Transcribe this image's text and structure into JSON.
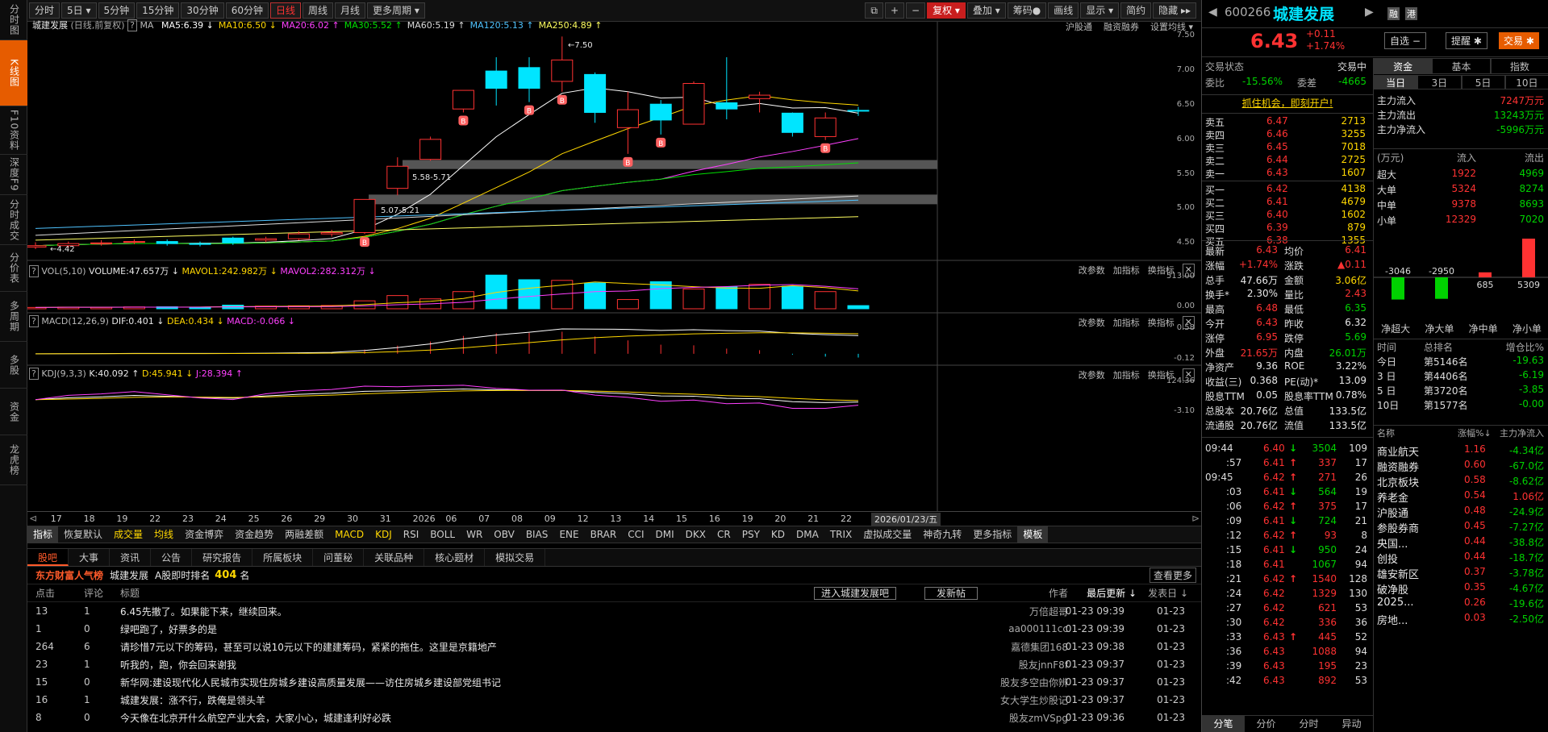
{
  "leftnav": [
    {
      "label": "分时图",
      "on": false,
      "h": 50
    },
    {
      "label": "K线图",
      "on": true,
      "h": 82
    },
    {
      "label": "F10资料",
      "on": false,
      "h": 60
    },
    {
      "label": "深度F9",
      "on": false,
      "h": 50
    },
    {
      "label": "分时成交",
      "on": false,
      "h": 62
    },
    {
      "label": "分价表",
      "on": false,
      "h": 58
    },
    {
      "label": "多周期",
      "on": false,
      "h": 62
    },
    {
      "label": "多股",
      "on": false,
      "h": 58
    },
    {
      "label": "资金",
      "on": false,
      "h": 58
    },
    {
      "label": "龙虎榜",
      "on": false,
      "h": 62
    }
  ],
  "toolbar": {
    "left": [
      "分时",
      "5日 ▾",
      "5分钟",
      "15分钟",
      "30分钟",
      "60分钟",
      "日线",
      "周线",
      "月线",
      "更多周期 ▾"
    ],
    "active": "日线",
    "right": [
      "⧉",
      "+",
      "−",
      "复权 ▾",
      "叠加 ▾",
      "筹码●",
      "画线",
      "显示 ▾",
      "简约",
      "隐藏 ▸▸"
    ]
  },
  "chart": {
    "title": "城建发展",
    "subtitle": "(日线,前复权)",
    "ma_label": "MA",
    "ma": [
      {
        "t": "MA5:6.39 ↓",
        "c": "#ffffff"
      },
      {
        "t": "MA10:6.50 ↓",
        "c": "#ffd700"
      },
      {
        "t": "MA20:6.02 ↑",
        "c": "#ff40ff"
      },
      {
        "t": "MA30:5.52 ↑",
        "c": "#00e000"
      },
      {
        "t": "MA60:5.19 ↑",
        "c": "#dddddd"
      },
      {
        "t": "MA120:5.13 ↑",
        "c": "#4fc3ff"
      },
      {
        "t": "MA250:4.89 ↑",
        "c": "#ffff60"
      }
    ],
    "toplinks": [
      "沪股通",
      "融资融券",
      "设置均线 ▾"
    ],
    "price_ticks": [
      "7.50",
      "7.00",
      "6.50",
      "6.00",
      "5.50",
      "5.00",
      "4.50"
    ],
    "hi_label": "←7.50",
    "lo_label": "←4.42",
    "zone1_label": "5.58-5.71",
    "zone2_label": "5.07-5.21",
    "vol": {
      "label": "VOL(5,10)",
      "v1": "VOLUME:47.657万 ↓",
      "v2": "MAVOL1:242.982万 ↓",
      "v3": "MAVOL2:282.312万 ↓",
      "ticks": [
        "513.00",
        "0.00"
      ]
    },
    "macd": {
      "label": "MACD(12,26,9)",
      "v1": "DIF:0.401 ↓",
      "v2": "DEA:0.434 ↓",
      "v3": "MACD:-0.066 ↓",
      "ticks": [
        "0.58",
        "-0.12"
      ]
    },
    "kdj": {
      "label": "KDJ(9,3,3)",
      "v1": "K:40.092 ↑",
      "v2": "D:45.941 ↓",
      "v3": "J:28.394 ↑",
      "ticks": [
        "124.36",
        "-3.10"
      ]
    },
    "panel_btns": [
      "改参数",
      "加指标",
      "换指标"
    ],
    "dates": [
      "17",
      "18",
      "19",
      "22",
      "23",
      "24",
      "25",
      "26",
      "29",
      "30",
      "31",
      "2026",
      "06",
      "07",
      "08",
      "09",
      "12",
      "13",
      "14",
      "15",
      "16",
      "19",
      "20",
      "21",
      "22"
    ],
    "date_box": "2026/01/23/五"
  },
  "chart_data": {
    "type": "candlestick",
    "ylim": [
      4.35,
      7.55
    ],
    "candles": [
      [
        4.45,
        4.47,
        4.42,
        4.52
      ],
      [
        4.47,
        4.5,
        4.44,
        4.53
      ],
      [
        4.5,
        4.51,
        4.47,
        4.55
      ],
      [
        4.52,
        4.53,
        4.49,
        4.56
      ],
      [
        4.53,
        4.5,
        4.47,
        4.56
      ],
      [
        4.5,
        4.49,
        4.46,
        4.53
      ],
      [
        4.58,
        4.51,
        4.48,
        4.6
      ],
      [
        4.55,
        4.57,
        4.52,
        4.6
      ],
      [
        4.57,
        4.64,
        4.55,
        4.68
      ],
      [
        4.64,
        4.66,
        4.6,
        4.7
      ],
      [
        4.66,
        5.14,
        4.64,
        5.14
      ],
      [
        5.3,
        5.62,
        5.2,
        5.75
      ],
      [
        5.72,
        6.01,
        5.7,
        6.05
      ],
      [
        6.45,
        6.72,
        6.4,
        6.72
      ],
      [
        7.0,
        6.75,
        6.5,
        7.2
      ],
      [
        7.05,
        6.75,
        6.55,
        7.2
      ],
      [
        6.85,
        7.16,
        6.7,
        7.5
      ],
      [
        6.95,
        6.4,
        6.25,
        6.98
      ],
      [
        6.18,
        6.44,
        5.8,
        6.7
      ],
      [
        6.52,
        6.29,
        6.08,
        6.58
      ],
      [
        6.23,
        6.82,
        6.23,
        6.85
      ],
      [
        6.54,
        6.45,
        6.3,
        7.2
      ],
      [
        6.6,
        6.65,
        6.4,
        6.7
      ],
      [
        6.39,
        6.11,
        6.05,
        6.4
      ],
      [
        6.05,
        6.32,
        6.0,
        6.4
      ],
      [
        6.43,
        6.42,
        6.35,
        6.48
      ]
    ],
    "volume_max": 513,
    "volume": [
      20,
      25,
      22,
      28,
      30,
      25,
      55,
      40,
      45,
      50,
      120,
      200,
      150,
      260,
      510,
      440,
      430,
      390,
      140,
      410,
      300,
      330,
      370,
      340,
      260,
      47.657
    ]
  },
  "quote": {
    "code": "600266",
    "name": "城建发展",
    "price": "6.43",
    "chg": "+0.11",
    "pct": "+1.74%",
    "btn_pick": "自选 −",
    "btn_remind": "提醒 ✱",
    "btn_trade": "交易 ✱",
    "tag1": "融",
    "tag2": "港",
    "trade_state": "交易状态",
    "trade_state_v": "交易中",
    "wb_label": "委比",
    "wb": "-15.56%",
    "wc_label": "委差",
    "wc": "-4665",
    "promo": "抓住机会，即刻开户!"
  },
  "sells": [
    {
      "n": "卖五",
      "p": "6.47",
      "v": "2713"
    },
    {
      "n": "卖四",
      "p": "6.46",
      "v": "3255"
    },
    {
      "n": "卖三",
      "p": "6.45",
      "v": "7018"
    },
    {
      "n": "卖二",
      "p": "6.44",
      "v": "2725"
    },
    {
      "n": "卖一",
      "p": "6.43",
      "v": "1607"
    }
  ],
  "buys": [
    {
      "n": "买一",
      "p": "6.42",
      "v": "4138"
    },
    {
      "n": "买二",
      "p": "6.41",
      "v": "4679"
    },
    {
      "n": "买三",
      "p": "6.40",
      "v": "1602"
    },
    {
      "n": "买四",
      "p": "6.39",
      "v": "879"
    },
    {
      "n": "买五",
      "p": "6.38",
      "v": "1355"
    }
  ],
  "stats": [
    [
      "最新",
      "6.43",
      "red",
      "均价",
      "6.41",
      "red"
    ],
    [
      "涨幅",
      "+1.74%",
      "red",
      "涨跌",
      "▲0.11",
      "red"
    ],
    [
      "总手",
      "47.66万",
      "wh",
      "金额",
      "3.06亿",
      "yel"
    ],
    [
      "换手*",
      "2.30%",
      "wh",
      "量比",
      "2.43",
      "red"
    ],
    [
      "最高",
      "6.48",
      "red",
      "最低",
      "6.35",
      "green"
    ],
    [
      "今开",
      "6.43",
      "red",
      "昨收",
      "6.32",
      "wh"
    ],
    [
      "涨停",
      "6.95",
      "red",
      "跌停",
      "5.69",
      "green"
    ],
    [
      "外盘",
      "21.65万",
      "red",
      "内盘",
      "26.01万",
      "green"
    ],
    [
      "净资产",
      "9.36",
      "wh",
      "ROE",
      "3.22%",
      "wh"
    ],
    [
      "收益(三)",
      "0.368",
      "wh",
      "PE(动)*",
      "13.09",
      "wh"
    ],
    [
      "股息TTM",
      "0.05",
      "wh",
      "股息率TTM",
      "0.78%",
      "wh"
    ],
    [
      "总股本",
      "20.76亿",
      "wh",
      "总值",
      "133.5亿",
      "wh"
    ],
    [
      "流通股",
      "20.76亿",
      "wh",
      "流值",
      "133.5亿",
      "wh"
    ]
  ],
  "ticks": [
    {
      "t": "09:44",
      "p": "6.40",
      "a": "↓",
      "c": "green",
      "v": "3504",
      "n": "109"
    },
    {
      "t": ":57",
      "p": "6.41",
      "a": "↑",
      "c": "red",
      "v": "337",
      "n": "17"
    },
    {
      "t": "09:45",
      "p": "6.42",
      "a": "↑",
      "c": "red",
      "v": "271",
      "n": "26"
    },
    {
      "t": ":03",
      "p": "6.41",
      "a": "↓",
      "c": "green",
      "v": "564",
      "n": "19"
    },
    {
      "t": ":06",
      "p": "6.42",
      "a": "↑",
      "c": "red",
      "v": "375",
      "n": "17"
    },
    {
      "t": ":09",
      "p": "6.41",
      "a": "↓",
      "c": "green",
      "v": "724",
      "n": "21"
    },
    {
      "t": ":12",
      "p": "6.42",
      "a": "↑",
      "c": "red",
      "v": "93",
      "n": "8"
    },
    {
      "t": ":15",
      "p": "6.41",
      "a": "↓",
      "c": "green",
      "v": "950",
      "n": "24"
    },
    {
      "t": ":18",
      "p": "6.41",
      "a": "",
      "c": "green",
      "v": "1067",
      "n": "94"
    },
    {
      "t": ":21",
      "p": "6.42",
      "a": "↑",
      "c": "red",
      "v": "1540",
      "n": "128"
    },
    {
      "t": ":24",
      "p": "6.42",
      "a": "",
      "c": "red",
      "v": "1329",
      "n": "130"
    },
    {
      "t": ":27",
      "p": "6.42",
      "a": "",
      "c": "red",
      "v": "621",
      "n": "53"
    },
    {
      "t": ":30",
      "p": "6.42",
      "a": "",
      "c": "red",
      "v": "336",
      "n": "36"
    },
    {
      "t": ":33",
      "p": "6.43",
      "a": "↑",
      "c": "red",
      "v": "445",
      "n": "52"
    },
    {
      "t": ":36",
      "p": "6.43",
      "a": "",
      "c": "red",
      "v": "1088",
      "n": "94"
    },
    {
      "t": ":39",
      "p": "6.43",
      "a": "",
      "c": "red",
      "v": "195",
      "n": "23"
    },
    {
      "t": ":42",
      "p": "6.43",
      "a": "",
      "c": "red",
      "v": "892",
      "n": "53"
    }
  ],
  "tick_tabs": [
    "分笔",
    "分价",
    "分时",
    "异动"
  ],
  "money": {
    "tabs": [
      "资金",
      "基本",
      "指数"
    ],
    "subtabs": [
      "当日",
      "3日",
      "5日",
      "10日"
    ],
    "rows": [
      {
        "l": "主力流入",
        "v": "7247万元",
        "c": "red"
      },
      {
        "l": "主力流出",
        "v": "13243万元",
        "c": "green"
      },
      {
        "l": "主力净流入",
        "v": "-5996万元",
        "c": "green"
      }
    ],
    "head": [
      "(万元)",
      "流入",
      "流出"
    ],
    "grid": [
      {
        "l": "超大",
        "i": "1922",
        "o": "4969"
      },
      {
        "l": "大单",
        "i": "5324",
        "o": "8274"
      },
      {
        "l": "中单",
        "i": "9378",
        "o": "8693"
      },
      {
        "l": "小单",
        "i": "12329",
        "o": "7020"
      }
    ],
    "bars": [
      {
        "v": "-3046",
        "val": -3046
      },
      {
        "v": "-2950",
        "val": -2950
      },
      {
        "v": "685",
        "val": 685
      },
      {
        "v": "5309",
        "val": 5309
      }
    ],
    "bar_labels": [
      "净超大",
      "净大单",
      "净中单",
      "净小单"
    ],
    "rank_head": [
      "时间",
      "总排名",
      "增仓比%"
    ],
    "rank": [
      {
        "t": "今日",
        "r": "第5146名",
        "p": "-19.63"
      },
      {
        "t": "3 日",
        "r": "第4406名",
        "p": "-6.19"
      },
      {
        "t": "5 日",
        "r": "第3720名",
        "p": "-3.85"
      },
      {
        "t": "10日",
        "r": "第1577名",
        "p": "-0.00"
      }
    ],
    "sec_head": [
      "名称",
      "涨幅%↓",
      "主力净流入"
    ],
    "sectors": [
      {
        "n": "商业航天",
        "p": "1.16",
        "f": "-4.34亿",
        "fc": "green"
      },
      {
        "n": "融资融券",
        "p": "0.60",
        "f": "-67.0亿",
        "fc": "green"
      },
      {
        "n": "北京板块",
        "p": "0.58",
        "f": "-8.62亿",
        "fc": "green"
      },
      {
        "n": "养老金",
        "p": "0.54",
        "f": "1.06亿",
        "fc": "red"
      },
      {
        "n": "沪股通",
        "p": "0.48",
        "f": "-24.9亿",
        "fc": "green"
      },
      {
        "n": "参股券商",
        "p": "0.45",
        "f": "-7.27亿",
        "fc": "green"
      },
      {
        "n": "央国...",
        "p": "0.44",
        "f": "-38.8亿",
        "fc": "green"
      },
      {
        "n": "创投",
        "p": "0.44",
        "f": "-18.7亿",
        "fc": "green"
      },
      {
        "n": "雄安新区",
        "p": "0.37",
        "f": "-3.78亿",
        "fc": "green"
      },
      {
        "n": "破净股",
        "p": "0.35",
        "f": "-4.67亿",
        "fc": "green"
      },
      {
        "n": "2025...",
        "p": "0.26",
        "f": "-19.6亿",
        "fc": "green"
      },
      {
        "n": "房地...",
        "p": "0.03",
        "f": "-2.50亿",
        "fc": "green"
      }
    ]
  },
  "indicator_tabs": [
    "指标",
    "恢复默认",
    "成交量",
    "均线",
    "资金博弈",
    "资金趋势",
    "两融差额",
    "MACD",
    "KDJ",
    "RSI",
    "BOLL",
    "WR",
    "OBV",
    "BIAS",
    "ENE",
    "BRAR",
    "CCI",
    "DMI",
    "DKX",
    "CR",
    "PSY",
    "KD",
    "DMA",
    "TRIX",
    "虚拟成交量",
    "神奇九转",
    "更多指标",
    "模板"
  ],
  "indicator_on": "指标",
  "indicator_yellow": [
    "成交量",
    "均线",
    "MACD",
    "KDJ"
  ],
  "forum": {
    "tabs": [
      "股吧",
      "大事",
      "资讯",
      "公告",
      "研究报告",
      "所属板块",
      "问董秘",
      "关联品种",
      "核心题材",
      "模拟交易"
    ],
    "active": "股吧",
    "brand": "东方财富人气榜",
    "stock": "城建发展",
    "rank_label": "A股即时排名",
    "rank": "404",
    "rank_unit": "名",
    "more": "查看更多",
    "h_click": "点击",
    "h_comment": "评论",
    "h_title": "标题",
    "btn_enter": "进入城建发展吧",
    "btn_post": "发新帖",
    "h_author": "作者",
    "h_update": "最后更新 ↓",
    "h_date": "发表日 ↓",
    "posts": [
      {
        "a": "13",
        "b": "1",
        "t": "6.45先撤了。如果能下来，继续回来。",
        "u": "万倍超哥",
        "d": "01-23 09:39",
        "e": "01-23"
      },
      {
        "a": "1",
        "b": "0",
        "t": "绿吧跑了，好票多的是",
        "u": "aa000111cc",
        "d": "01-23 09:39",
        "e": "01-23"
      },
      {
        "a": "264",
        "b": "6",
        "t": "请珍惜7元以下的筹码，甚至可以说10元以下的建建筹码，紧紧的拖住。这里是京籍地产",
        "u": "嘉德集团168",
        "d": "01-23 09:38",
        "e": "01-23"
      },
      {
        "a": "23",
        "b": "1",
        "t": "听我的，跑，你会回来谢我",
        "u": "股友jnnF8f",
        "d": "01-23 09:37",
        "e": "01-23"
      },
      {
        "a": "15",
        "b": "0",
        "t": "新华网:建设现代化人民城市实现住房城乡建设高质量发展——访住房城乡建设部党组书记",
        "u": "股友多空由你辨",
        "d": "01-23 09:37",
        "e": "01-23"
      },
      {
        "a": "16",
        "b": "1",
        "t": "城建发展：涨不行，跌俺是领头羊",
        "u": "女大学生炒股记",
        "d": "01-23 09:37",
        "e": "01-23"
      },
      {
        "a": "8",
        "b": "0",
        "t": "今天像在北京开什么航空产业大会，大家小心，城建逢利好必跌",
        "u": "股友zmVSpg",
        "d": "01-23 09:36",
        "e": "01-23"
      }
    ]
  }
}
